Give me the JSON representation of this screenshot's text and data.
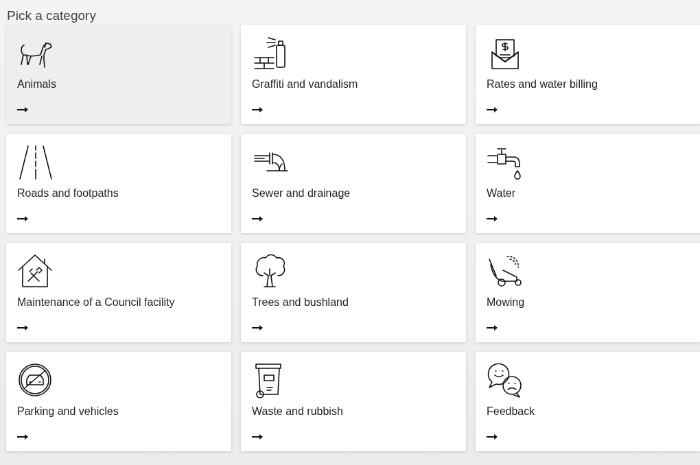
{
  "heading": "Pick a category",
  "categories": [
    {
      "label": "Animals",
      "selected": true
    },
    {
      "label": "Graffiti and vandalism",
      "selected": false
    },
    {
      "label": "Rates and water billing",
      "selected": false
    },
    {
      "label": "Roads and footpaths",
      "selected": false
    },
    {
      "label": "Sewer and drainage",
      "selected": false
    },
    {
      "label": "Water",
      "selected": false
    },
    {
      "label": "Maintenance of a Council facility",
      "selected": false
    },
    {
      "label": "Trees and bushland",
      "selected": false
    },
    {
      "label": "Mowing",
      "selected": false
    },
    {
      "label": "Parking and vehicles",
      "selected": false
    },
    {
      "label": "Waste and rubbish",
      "selected": false
    },
    {
      "label": "Feedback",
      "selected": false
    }
  ]
}
